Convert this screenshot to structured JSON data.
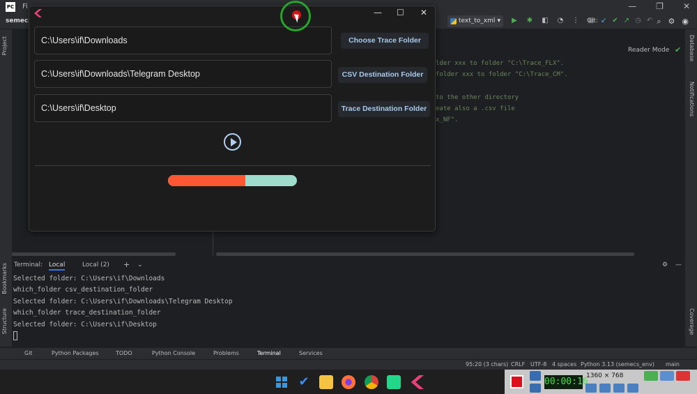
{
  "ide": {
    "logo": "PC",
    "menu_text": "Fi",
    "project_name": "semecs",
    "run_config": "text_to_xml",
    "git_label": "Git:",
    "reader_mode": "Reader Mode",
    "left_labels": {
      "project": "Project",
      "bookmarks": "Bookmarks",
      "structure": "Structure"
    },
    "right_labels": {
      "database": "Database",
      "notifications": "Notifications",
      "coverage": "Coverage"
    },
    "code_lines": [
      "lder xxx to folder \"C:\\Trace_FLX\".",
      "folder xxx to folder \"C:\\Trace_CM\".",
      "to the other directory",
      "eate also a .csv file",
      "x_NF\"."
    ],
    "terminal_tabs": [
      "Terminal:",
      "Local",
      "Local (2)"
    ],
    "terminal_lines": [
      "Selected folder: C:\\Users\\if\\Downloads",
      "which_folder csv_destination_folder",
      "Selected folder: C:\\Users\\if\\Downloads\\Telegram Desktop",
      "which_folder trace_destination_folder",
      "Selected folder: C:\\Users\\if\\Desktop"
    ],
    "bottom_tabs": [
      "Git",
      "Python Packages",
      "TODO",
      "Python Console",
      "Problems",
      "Terminal",
      "Services"
    ],
    "status": {
      "position": "95:20 (3 chars)",
      "line_sep": "CRLF",
      "encoding": "UTF-8",
      "indent": "4 spaces",
      "interpreter": "Python 3.13 (semecs_env)",
      "branch": "main"
    }
  },
  "app": {
    "paths": {
      "trace_source": "C:\\Users\\if\\Downloads",
      "csv_destination": "C:\\Users\\if\\Downloads\\Telegram Desktop",
      "trace_destination": "C:\\Users\\if\\Desktop"
    },
    "buttons": {
      "choose_trace": "Choose Trace Folder",
      "csv_destination": "CSV Destination Folder",
      "trace_destination": "Trace Destination Folder"
    },
    "progress": 0.6,
    "colors": {
      "progress_fill": "#ff5733",
      "progress_track": "#9fdccc",
      "accent": "#b3cff0"
    }
  },
  "recorder": {
    "timer": "00:00:16",
    "size": "1360 × 768"
  }
}
